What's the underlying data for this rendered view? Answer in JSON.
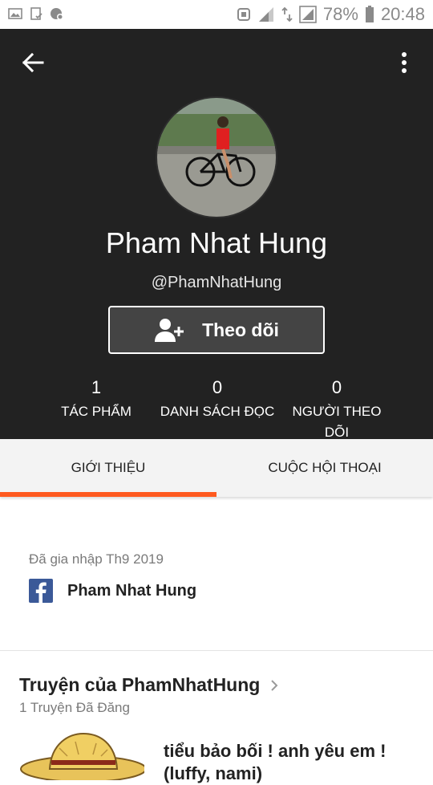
{
  "status_bar": {
    "battery_percent": "78%",
    "time": "20:48",
    "left_icons": [
      "image-icon",
      "clipboard-check-icon",
      "shield-settings-icon"
    ],
    "right_icons": [
      "nfc-icon",
      "signal-icon",
      "data-arrows-icon",
      "signal-box-icon",
      "battery-icon"
    ]
  },
  "profile": {
    "name": "Pham Nhat Hung",
    "handle": "@PhamNhatHung",
    "follow_label": "Theo dõi",
    "stats": [
      {
        "value": "1",
        "label": "TÁC PHẨM"
      },
      {
        "value": "0",
        "label": "DANH SÁCH ĐỌC"
      },
      {
        "value": "0",
        "label": "NGƯỜI THEO DÕI"
      }
    ]
  },
  "tabs": [
    {
      "label": "GIỚI THIỆU",
      "active": true
    },
    {
      "label": "CUỘC HỘI THOẠI",
      "active": false
    }
  ],
  "about": {
    "joined": "Đã gia nhập Th9 2019",
    "facebook_name": "Pham Nhat Hung"
  },
  "stories": {
    "title": "Truyện của PhamNhatHung",
    "count_text": "1 Truyện Đã Đăng",
    "items": [
      {
        "title": "tiểu bảo bối ! anh yêu em !(luffy, nami)"
      }
    ]
  },
  "colors": {
    "header_bg": "#222222",
    "accent": "#ff5a1f",
    "facebook": "#3b5998"
  }
}
